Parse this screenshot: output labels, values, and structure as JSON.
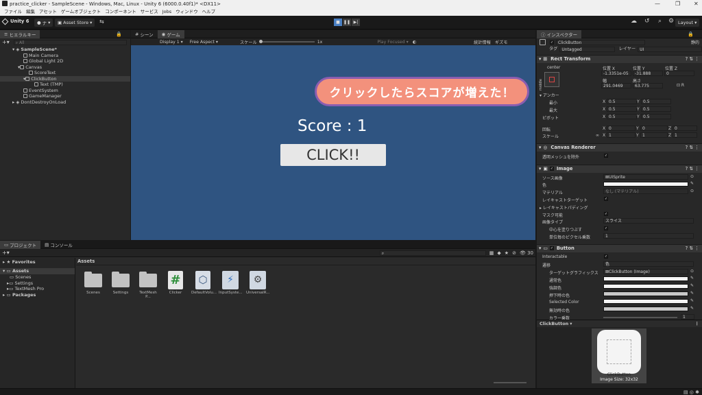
{
  "window": {
    "title": "practice_clicker - SampleScene - Windows, Mac, Linux - Unity 6 (6000.0.40f1)* <DX11>",
    "controls": [
      "—",
      "❐",
      "✕"
    ]
  },
  "menu": [
    "ファイル",
    "編集",
    "アセット",
    "ゲームオブジェクト",
    "コンポーネント",
    "サービス",
    "Jobs",
    "ウィンドウ",
    "ヘルプ"
  ],
  "toolbar": {
    "unity_label": "Unity 6",
    "account_label": "ナ",
    "asset_store": "Asset Store",
    "layout_label": "Layout"
  },
  "hierarchy": {
    "tab": "ヒエラルキー",
    "search_placeholder": "All",
    "items": [
      {
        "label": "SampleScene*",
        "indent": 0
      },
      {
        "label": "Main Camera",
        "indent": 1
      },
      {
        "label": "Global Light 2D",
        "indent": 1
      },
      {
        "label": "Canvas",
        "indent": 1
      },
      {
        "label": "ScoreText",
        "indent": 2
      },
      {
        "label": "ClickButton",
        "indent": 2
      },
      {
        "label": "Text (TMP)",
        "indent": 3
      },
      {
        "label": "EventSystem",
        "indent": 1
      },
      {
        "label": "GameManager",
        "indent": 1
      },
      {
        "label": "DontDestroyOnLoad",
        "indent": 0
      }
    ]
  },
  "game": {
    "tabs": [
      "シーン",
      "ゲーム"
    ],
    "display": "Display 1",
    "aspect": "Free Aspect",
    "scale_label": "スケール",
    "scale_value": "1x",
    "play_focused": "Play Focused",
    "stats": "統計情報",
    "gizmos": "ギズモ",
    "callout": "クリックしたらスコアが増えた！",
    "score": "Score : 1",
    "button": "CLICK!!"
  },
  "project": {
    "tabs": [
      "プロジェクト",
      "コンソール"
    ],
    "favorites": "Favorites",
    "tree": [
      "Assets",
      "Scenes",
      "Settings",
      "TextMesh Pro",
      "Packages"
    ],
    "breadcrumb": "Assets",
    "count": "30",
    "assets": [
      "Scenes",
      "Settings",
      "TextMesh P...",
      "Clicker",
      "DefaultVolu...",
      "InputSyste...",
      "UniversalR..."
    ]
  },
  "inspector": {
    "tab": "インスペクター",
    "object_name": "ClickButton",
    "static_label": "静的",
    "tag_label": "タグ",
    "tag_value": "Untagged",
    "layer_label": "レイヤー",
    "layer_value": "UI",
    "rect": {
      "title": "Rect Transform",
      "anchor_h": "center",
      "anchor_v": "middle",
      "pos_headers": [
        "位置 X",
        "位置 Y",
        "位置 Z"
      ],
      "pos_values": [
        "-1.3351e-05",
        "-31.888",
        "0"
      ],
      "size_headers": [
        "幅",
        "高さ"
      ],
      "size_values": [
        "291.0469",
        "63.775"
      ],
      "anchors_label": "アンカー",
      "min_label": "最小",
      "min": [
        "0.5",
        "0.5"
      ],
      "max_label": "最大",
      "max": [
        "0.5",
        "0.5"
      ],
      "pivot_label": "ピボット",
      "pivot": [
        "0.5",
        "0.5"
      ],
      "rotation_label": "回転",
      "rotation": [
        "0",
        "0",
        "0"
      ],
      "scale_label": "スケール",
      "scale": [
        "1",
        "1",
        "1"
      ]
    },
    "canvas_renderer": {
      "title": "Canvas Renderer",
      "cull_label": "透明メッシュを除外"
    },
    "image": {
      "title": "Image",
      "source_label": "ソース画像",
      "source_value": "UISprite",
      "color_label": "色",
      "material_label": "マテリアル",
      "material_value": "なし (マテリアル)",
      "raycast_label": "レイキャストターゲット",
      "padding_label": "レイキャストパディング",
      "mask_label": "マスク可能",
      "type_label": "画像タイプ",
      "type_value": "スライス",
      "fill_center_label": "中心を塗りつぶす",
      "ppu_label": "単位毎のピクセル乗数",
      "ppu_value": "1"
    },
    "button": {
      "title": "Button",
      "interactable_label": "Interactable",
      "transition_label": "遷移",
      "transition_value": "色",
      "target_label": "ターゲットグラフィックス",
      "target_value": "ClickButton (Image)",
      "normal_label": "通常色",
      "highlight_label": "強調色",
      "pressed_label": "押下時の色",
      "selected_label": "Selected Color",
      "disabled_label": "無効時の色",
      "multiplier_label": "カラー乗数",
      "multiplier_value": "1"
    },
    "preview_title": "ClickButton",
    "preview_caption": "ClickButton",
    "preview_size": "Image Size: 32x32"
  },
  "colors": {
    "game_bg": "#2f5481",
    "callout_fill": "#f3917c",
    "callout_border": "#8a5db0",
    "button_fill": "#e7e7e7"
  }
}
